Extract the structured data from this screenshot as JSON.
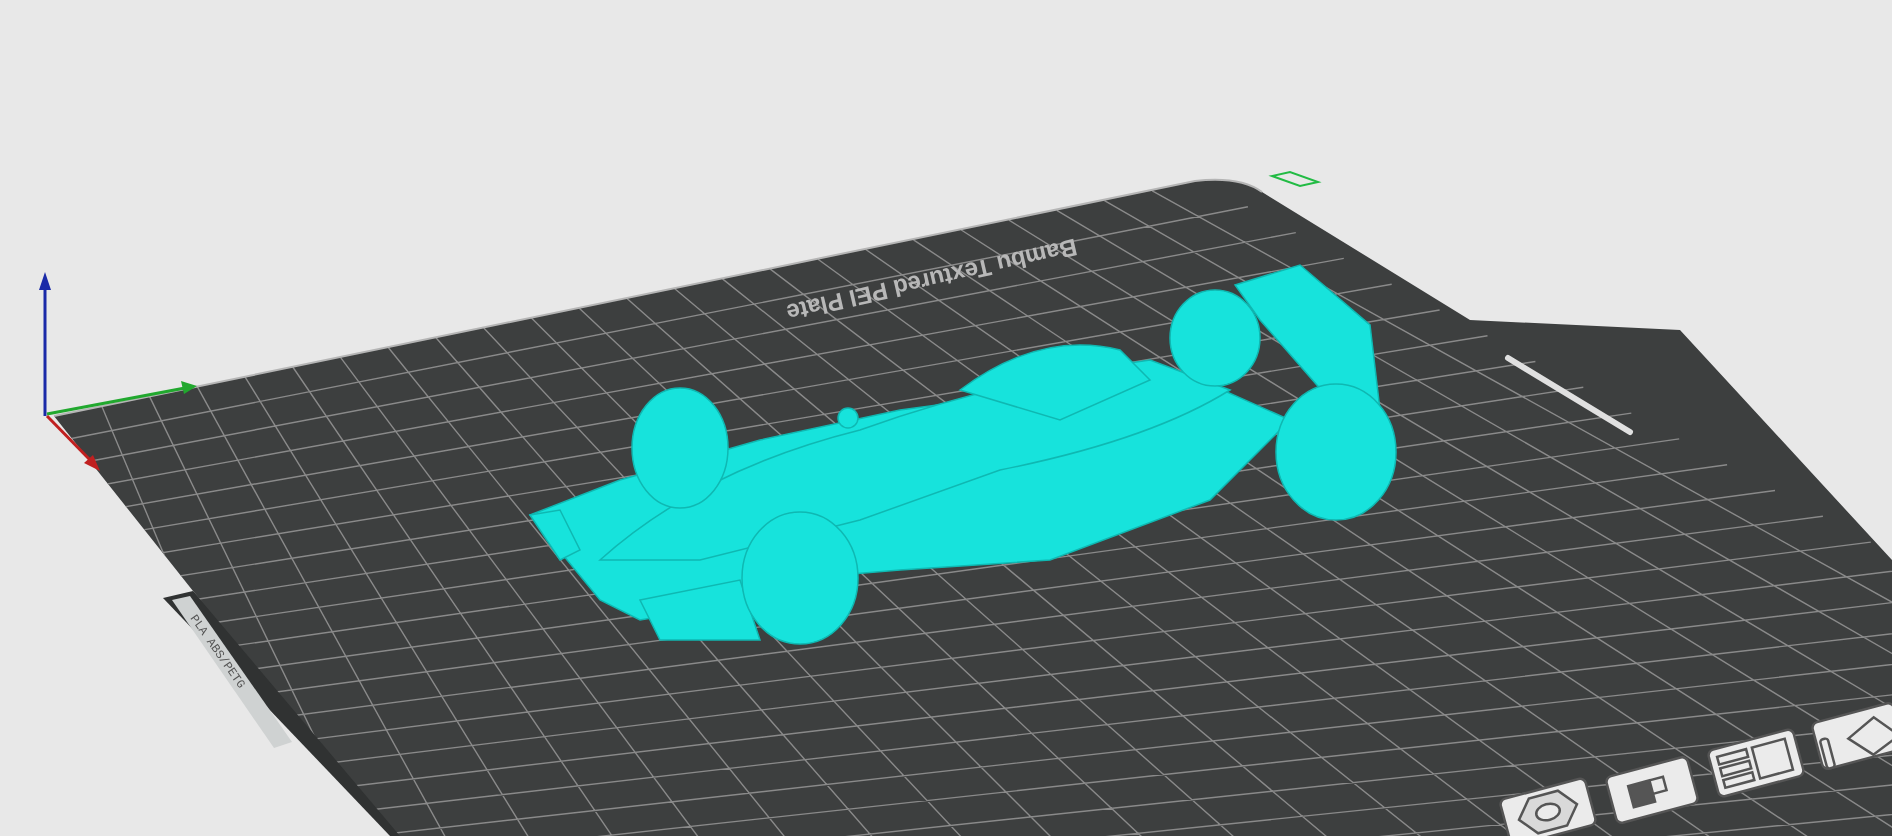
{
  "viewport": {
    "plate_name": "Bambu Textured PEI Plate",
    "plate_label": "PLA ABS/PETG"
  }
}
